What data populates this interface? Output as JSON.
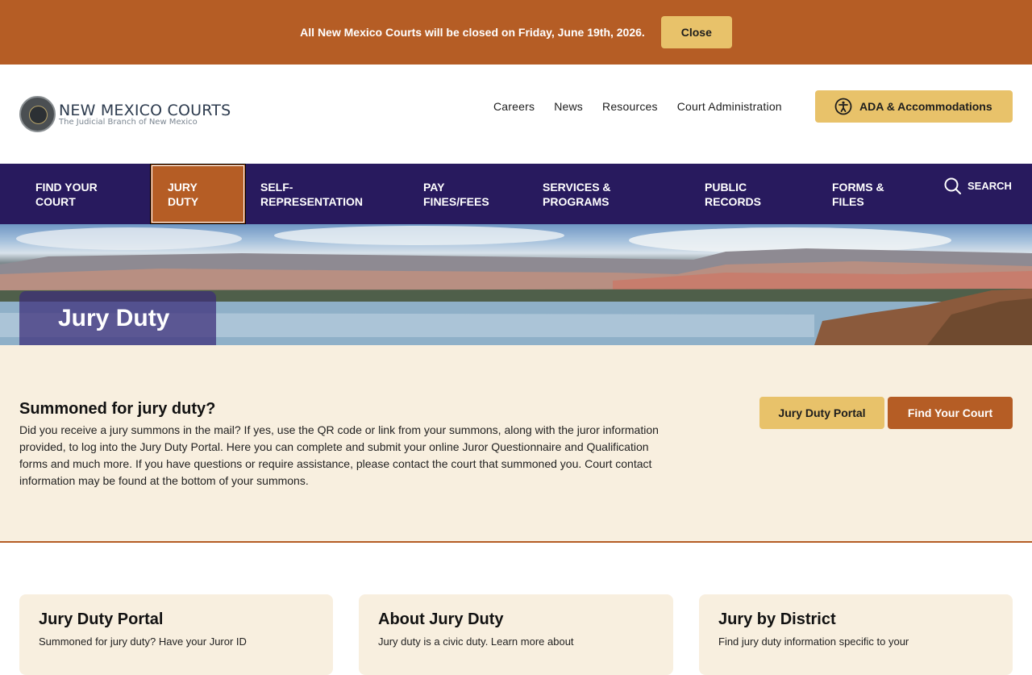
{
  "alert": {
    "message": "All New Mexico Courts will be closed on Friday, June 19th, 2026.",
    "close_label": "Close"
  },
  "header": {
    "logo_title": "NEW MEXICO COURTS",
    "logo_subtitle": "The Judicial Branch of New Mexico",
    "utility_nav": [
      "Careers",
      "News",
      "Resources",
      "Court Administration"
    ],
    "ada_label": "ADA & Accommodations"
  },
  "mainnav": {
    "items": [
      {
        "line1": "FIND YOUR",
        "line2": "COURT"
      },
      {
        "line1": "JURY",
        "line2": "DUTY"
      },
      {
        "line1": "SELF-",
        "line2": "REPRESENTATION"
      },
      {
        "line1": "PAY",
        "line2": "FINES/FEES"
      },
      {
        "line1": "SERVICES &",
        "line2": "PROGRAMS"
      },
      {
        "line1": "PUBLIC",
        "line2": "RECORDS"
      },
      {
        "line1": "FORMS &",
        "line2": "FILES"
      }
    ],
    "active_index": 1,
    "search_label": "SEARCH"
  },
  "hero": {
    "title": "Jury Duty"
  },
  "summon": {
    "title": "Summoned for jury duty?",
    "body": "Did you receive a jury summons in the mail? If yes, use the QR code or link from your summons, along with the juror information provided, to log into the Jury Duty Portal. Here you can complete and submit your online Juror Questionnaire and Qualification forms and much more. If you have questions or require assistance, please contact the court that summoned you. Court contact information may be found at the bottom of your summons.",
    "portal_button": "Jury Duty Portal",
    "find_court_button": "Find Your Court"
  },
  "cards": [
    {
      "title": "Jury Duty Portal",
      "text": "Summoned for jury duty? Have your Juror ID"
    },
    {
      "title": "About Jury Duty",
      "text": "Jury duty is a civic duty. Learn more about"
    },
    {
      "title": "Jury by District",
      "text": "Find jury duty information specific to your"
    }
  ],
  "colors": {
    "brand_orange": "#b55d25",
    "brand_gold": "#e8c26a",
    "nav_purple": "#281a5e",
    "cream": "#f8efdf"
  }
}
